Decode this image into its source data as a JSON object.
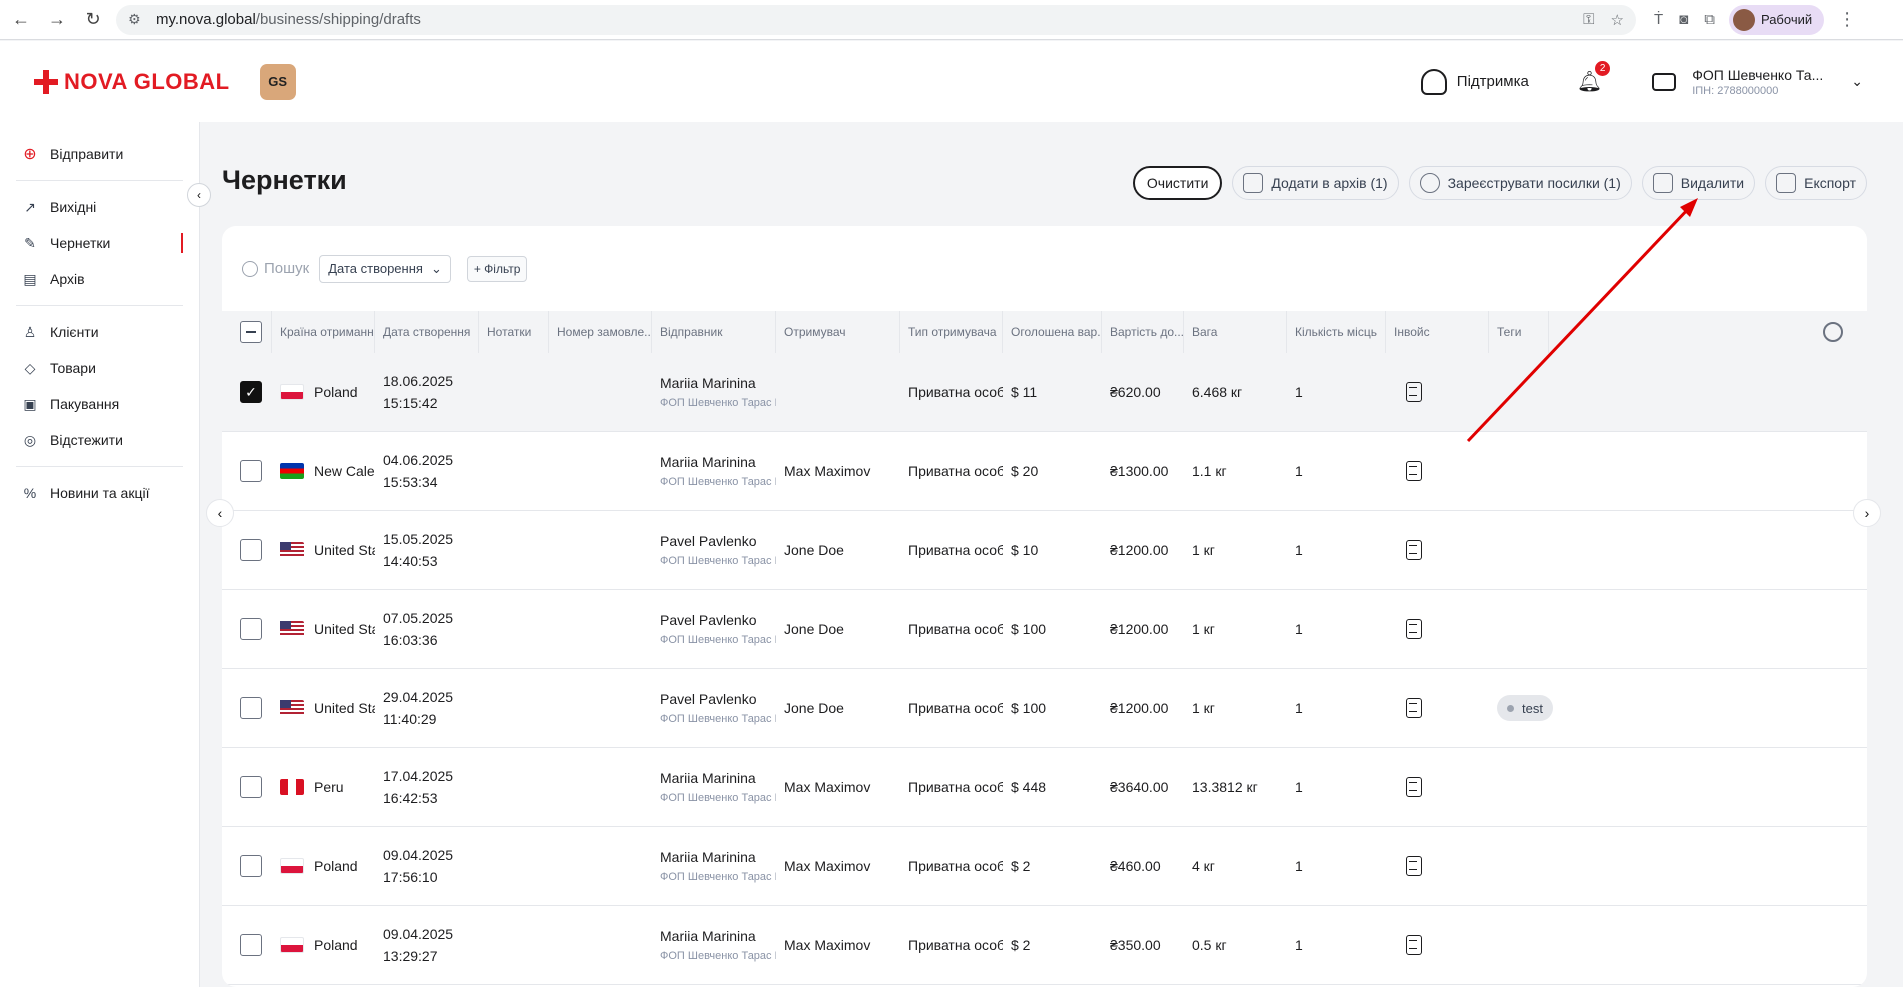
{
  "browser": {
    "url_host": "my.nova.global",
    "url_path": "/business/shipping/drafts",
    "profile_label": "Рабочий"
  },
  "header": {
    "logo_text": "NOVA GLOBAL",
    "badge_text": "GS",
    "support_label": "Підтримка",
    "notifications_count": "2",
    "account_name": "ФОП Шевченко Та...",
    "account_inn": "ІПН: 2788000000"
  },
  "sidebar": {
    "send_label": "Відправити",
    "items": [
      {
        "label": "Вихідні",
        "icon": "↗"
      },
      {
        "label": "Чернетки",
        "icon": "✎"
      },
      {
        "label": "Архів",
        "icon": "▤"
      },
      {
        "label": "Клієнти",
        "icon": "♙"
      },
      {
        "label": "Товари",
        "icon": "◇"
      },
      {
        "label": "Пакування",
        "icon": "▣"
      },
      {
        "label": "Відстежити",
        "icon": "◎"
      },
      {
        "label": "Новини та акції",
        "icon": "%"
      }
    ]
  },
  "page": {
    "title": "Чернетки",
    "actions": {
      "clear": "Очистити",
      "archive": "Додати в архів (1)",
      "register": "Зареєструвати посилки (1)",
      "delete": "Видалити",
      "export": "Експорт"
    }
  },
  "toolbar": {
    "search_placeholder": "Пошук",
    "date_select": "Дата створення",
    "filter_button": "+ Фільтр"
  },
  "table": {
    "columns": [
      "Країна отримання",
      "Дата створення",
      "Нотатки",
      "Номер замовле...",
      "Відправник",
      "Отримувач",
      "Тип отримувача",
      "Оголошена вар...",
      "Вартість до...",
      "Вага",
      "Кількість місць",
      "Інвойс",
      "Теги"
    ],
    "rows": [
      {
        "checked": true,
        "flag": "pl",
        "country": "Poland",
        "date": "18.06.2025",
        "time": "15:15:42",
        "sender": "Mariia Marinina",
        "sender_sub": "ФОП Шевченко Тарас Г...",
        "recipient": "",
        "type": "Приватна особа",
        "declared": "$ 11",
        "cost": "₴620.00",
        "weight": "6.468 кг",
        "places": "1",
        "tag": ""
      },
      {
        "checked": false,
        "flag": "nc",
        "country": "New Caled...",
        "date": "04.06.2025",
        "time": "15:53:34",
        "sender": "Mariia Marinina",
        "sender_sub": "ФОП Шевченко Тарас Г...",
        "recipient": "Max Maximov",
        "type": "Приватна особа",
        "declared": "$ 20",
        "cost": "₴1300.00",
        "weight": "1.1 кг",
        "places": "1",
        "tag": ""
      },
      {
        "checked": false,
        "flag": "us",
        "country": "United Stat...",
        "date": "15.05.2025",
        "time": "14:40:53",
        "sender": "Pavel Pavlenko",
        "sender_sub": "ФОП Шевченко Тарас Г...",
        "recipient": "Jone Doe",
        "type": "Приватна особа",
        "declared": "$ 10",
        "cost": "₴1200.00",
        "weight": "1 кг",
        "places": "1",
        "tag": ""
      },
      {
        "checked": false,
        "flag": "us",
        "country": "United Stat...",
        "date": "07.05.2025",
        "time": "16:03:36",
        "sender": "Pavel Pavlenko",
        "sender_sub": "ФОП Шевченко Тарас Г...",
        "recipient": "Jone Doe",
        "type": "Приватна особа",
        "declared": "$ 100",
        "cost": "₴1200.00",
        "weight": "1 кг",
        "places": "1",
        "tag": ""
      },
      {
        "checked": false,
        "flag": "us",
        "country": "United Stat...",
        "date": "29.04.2025",
        "time": "11:40:29",
        "sender": "Pavel Pavlenko",
        "sender_sub": "ФОП Шевченко Тарас Г...",
        "recipient": "Jone Doe",
        "type": "Приватна особа",
        "declared": "$ 100",
        "cost": "₴1200.00",
        "weight": "1 кг",
        "places": "1",
        "tag": "test"
      },
      {
        "checked": false,
        "flag": "pe",
        "country": "Peru",
        "date": "17.04.2025",
        "time": "16:42:53",
        "sender": "Mariia Marinina",
        "sender_sub": "ФОП Шевченко Тарас Г...",
        "recipient": "Max Maximov",
        "type": "Приватна особа",
        "declared": "$ 448",
        "cost": "₴3640.00",
        "weight": "13.3812 кг",
        "places": "1",
        "tag": ""
      },
      {
        "checked": false,
        "flag": "pl",
        "country": "Poland",
        "date": "09.04.2025",
        "time": "17:56:10",
        "sender": "Mariia Marinina",
        "sender_sub": "ФОП Шевченко Тарас Г...",
        "recipient": "Max Maximov",
        "type": "Приватна особа",
        "declared": "$ 2",
        "cost": "₴460.00",
        "weight": "4 кг",
        "places": "1",
        "tag": ""
      },
      {
        "checked": false,
        "flag": "pl",
        "country": "Poland",
        "date": "09.04.2025",
        "time": "13:29:27",
        "sender": "Mariia Marinina",
        "sender_sub": "ФОП Шевченко Тарас Г...",
        "recipient": "Max Maximov",
        "type": "Приватна особа",
        "declared": "$ 2",
        "cost": "₴350.00",
        "weight": "0.5 кг",
        "places": "1",
        "tag": ""
      }
    ]
  },
  "colors": {
    "brand": "#e21b23",
    "annotation_arrow": "#e00000"
  }
}
